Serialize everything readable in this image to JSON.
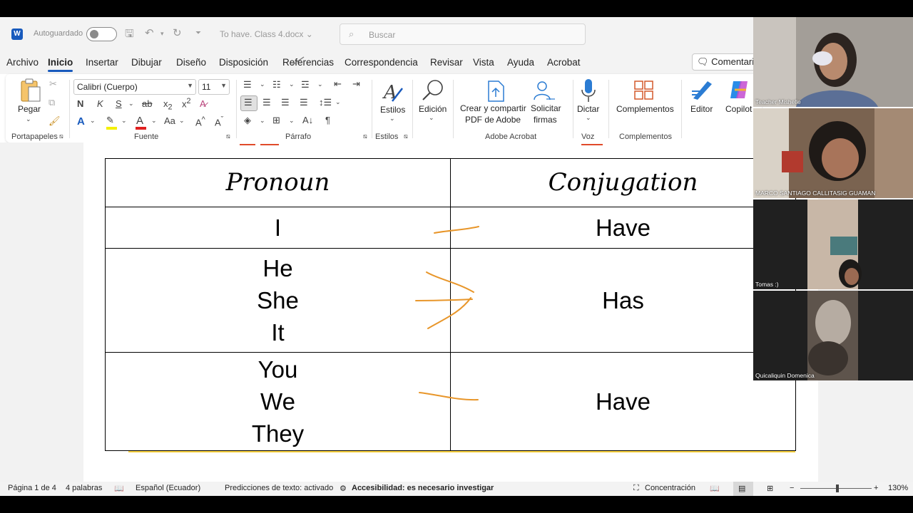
{
  "titlebar": {
    "autosave_label": "Autoguardado",
    "doc_title": "To have. Class 4.docx",
    "search_placeholder": "Buscar"
  },
  "menu": {
    "items": [
      "Archivo",
      "Inicio",
      "Insertar",
      "Dibujar",
      "Diseño",
      "Disposición",
      "Referencias",
      "Correspondencia",
      "Revisar",
      "Vista",
      "Ayuda",
      "Acrobat"
    ],
    "active": "Inicio",
    "comments": "Comentarios"
  },
  "ribbon": {
    "paste": "Pegar",
    "font_name": "Calibri (Cuerpo)",
    "font_size": "11",
    "styles": "Estilos",
    "edit": "Edición",
    "create_pdf_line1": "Crear y compartir",
    "create_pdf_line2": "PDF de Adobe",
    "request_line1": "Solicitar",
    "request_line2": "firmas",
    "dictate": "Dictar",
    "addins": "Complementos",
    "editor": "Editor",
    "copilot": "Copilot",
    "groups": {
      "clipboard": "Portapapeles",
      "font": "Fuente",
      "paragraph": "Párrafo",
      "styles": "Estilos",
      "acrobat": "Adobe Acrobat",
      "voice": "Voz",
      "addins": "Complementos"
    }
  },
  "table": {
    "headers": [
      "Pronoun",
      "Conjugation"
    ],
    "rows": [
      {
        "pronouns": [
          "I"
        ],
        "verb": "Have"
      },
      {
        "pronouns": [
          "He",
          "She",
          "It"
        ],
        "verb": "Has"
      },
      {
        "pronouns": [
          "You",
          "We",
          "They"
        ],
        "verb": "Have"
      }
    ]
  },
  "status": {
    "page": "Página 1 de 4",
    "words": "4 palabras",
    "language": "Español (Ecuador)",
    "predictions": "Predicciones de texto: activado",
    "accessibility": "Accesibilidad: es necesario investigar",
    "focus": "Concentración",
    "zoom": "130%"
  },
  "participants": [
    {
      "name": "Teacher Mishelle"
    },
    {
      "name": "MARCO SANTIAGO CALLITASIG GUAMAN"
    },
    {
      "name": "Tomas  :)"
    },
    {
      "name": "Quicaliquin Domenica"
    }
  ],
  "colors": {
    "word_blue": "#185abd",
    "ink_orange": "#e8962a"
  }
}
